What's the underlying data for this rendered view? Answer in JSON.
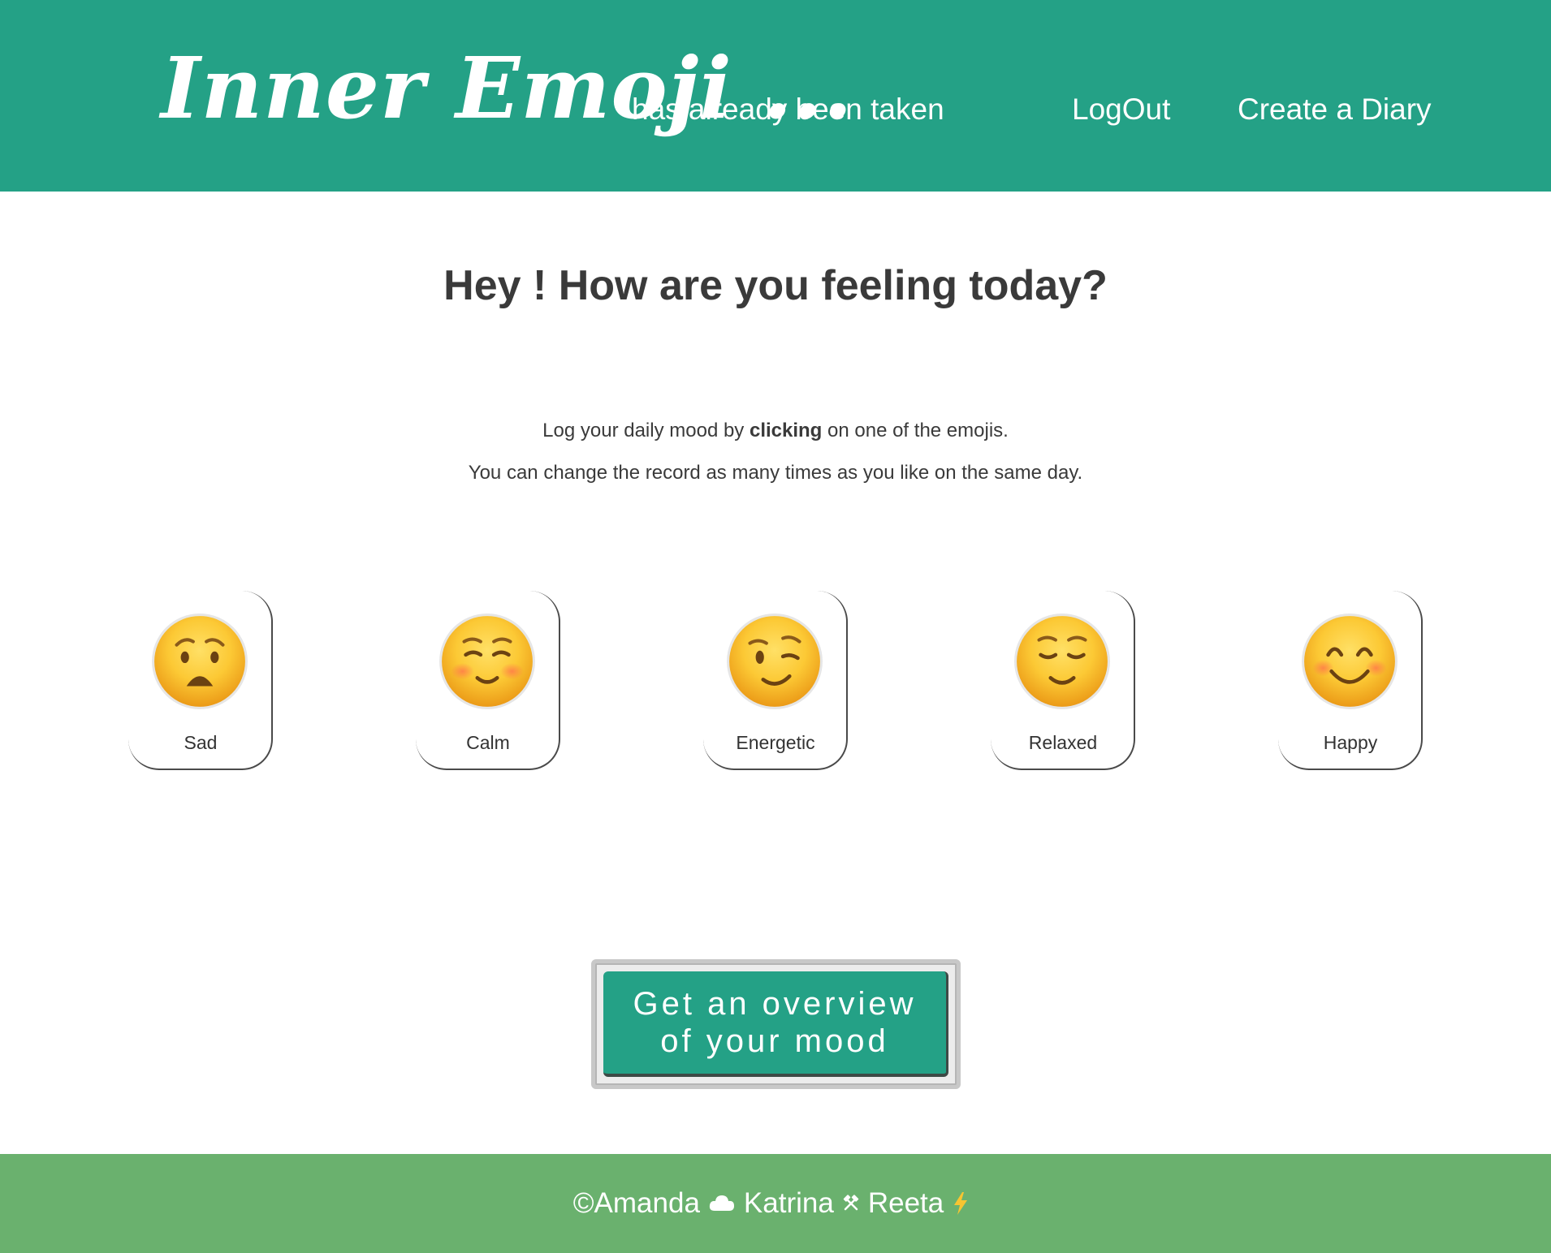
{
  "colors": {
    "header_bg": "#24a186",
    "footer_bg": "#6ab16e",
    "button_bg": "#24a186",
    "text_dark": "#3a3a3a"
  },
  "header": {
    "logo": "Inner Emoji ...",
    "subtitle": "has already been taken",
    "nav": {
      "logout": "LogOut",
      "create_diary": "Create a Diary"
    }
  },
  "main": {
    "title": "Hey ! How are you feeling today?",
    "instruction_pre": "Log your daily mood by ",
    "instruction_bold": "clicking",
    "instruction_post": " on one of the emojis.",
    "instruction_2": "You can change the record as many times as you like on the same day.",
    "moods": [
      {
        "label": "Sad",
        "icon": "anxious-face-icon"
      },
      {
        "label": "Calm",
        "icon": "blushing-face-icon"
      },
      {
        "label": "Energetic",
        "icon": "winking-face-icon"
      },
      {
        "label": "Relaxed",
        "icon": "relieved-face-icon"
      },
      {
        "label": "Happy",
        "icon": "smiling-face-icon"
      }
    ],
    "cta_label": "Get an overview of your mood"
  },
  "footer": {
    "name_1": "©Amanda",
    "name_2": "Katrina",
    "name_3": "Reeta",
    "icons": [
      "cloud-icon",
      "crossed-hammers-icon",
      "lightning-icon"
    ]
  }
}
